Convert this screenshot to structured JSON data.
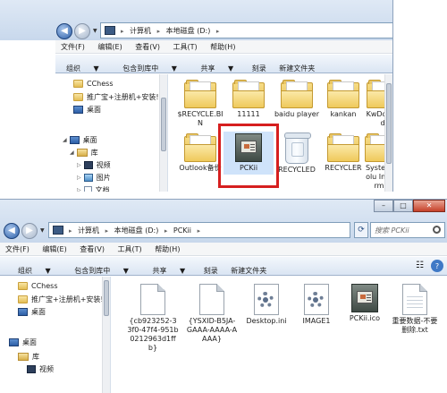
{
  "window1": {
    "breadcrumb": [
      "计算机",
      "本地磁盘 (D:)"
    ],
    "menu": [
      "文件(F)",
      "编辑(E)",
      "查看(V)",
      "工具(T)",
      "帮助(H)"
    ],
    "commands": {
      "organize": "组织",
      "include_in_library": "包含到库中",
      "share": "共享",
      "burn": "刻录",
      "new_folder": "新建文件夹"
    },
    "nav": {
      "items": [
        {
          "label": "CChess",
          "icon": "folder-icon"
        },
        {
          "label": "推广宝+注册机+安装!",
          "icon": "folder-icon"
        },
        {
          "label": "桌面",
          "icon": "desktop-icon"
        },
        {
          "label": "桌面",
          "icon": "desktop-icon"
        },
        {
          "label": "库",
          "icon": "library-icon"
        },
        {
          "label": "视频",
          "icon": "video-icon"
        },
        {
          "label": "图片",
          "icon": "picture-icon"
        },
        {
          "label": "文档",
          "icon": "document-icon"
        }
      ]
    },
    "files": [
      {
        "label": "$RECYCLE.BIN",
        "icon": "folder-icon"
      },
      {
        "label": "11111",
        "icon": "folder-icon"
      },
      {
        "label": "baidu player",
        "icon": "folder-icon"
      },
      {
        "label": "kankan",
        "icon": "folder-icon"
      },
      {
        "label": "KwDow ad",
        "icon": "folder-icon"
      },
      {
        "label": "Outlook备份",
        "icon": "folder-icon"
      },
      {
        "label": "PCKii",
        "icon": "application-icon"
      },
      {
        "label": "RECYCLED",
        "icon": "recycle-bin-icon"
      },
      {
        "label": "RECYCLER",
        "icon": "folder-icon"
      },
      {
        "label": "Syste Volu Inform",
        "icon": "folder-icon"
      }
    ]
  },
  "window2": {
    "breadcrumb": [
      "计算机",
      "本地磁盘 (D:)",
      "PCKii"
    ],
    "search_placeholder": "搜索 PCKii",
    "menu": [
      "文件(F)",
      "编辑(E)",
      "查看(V)",
      "工具(T)",
      "帮助(H)"
    ],
    "commands": {
      "organize": "组织",
      "include_in_library": "包含到库中",
      "share": "共享",
      "burn": "刻录",
      "new_folder": "新建文件夹"
    },
    "nav": {
      "items": [
        {
          "label": "CChess",
          "icon": "folder-icon"
        },
        {
          "label": "推广宝+注册机+安装!",
          "icon": "folder-icon"
        },
        {
          "label": "桌面",
          "icon": "desktop-icon"
        },
        {
          "label": "桌面",
          "icon": "desktop-icon"
        },
        {
          "label": "库",
          "icon": "library-icon"
        },
        {
          "label": "视频",
          "icon": "video-icon"
        }
      ]
    },
    "files": [
      {
        "label": "{cb923252-33f0-47f4-951b0212963d1ffb}",
        "icon": "document-icon"
      },
      {
        "label": "{YSXID-B5JA-GAAA-AAAA-AAAA}",
        "icon": "document-icon"
      },
      {
        "label": "Desktop.ini",
        "icon": "settings-file-icon"
      },
      {
        "label": "IMAGE1",
        "icon": "image-file-icon"
      },
      {
        "label": "PCKii.ico",
        "icon": "application-icon"
      },
      {
        "label": "重要数据-不要删除.txt",
        "icon": "document-icon"
      }
    ]
  }
}
